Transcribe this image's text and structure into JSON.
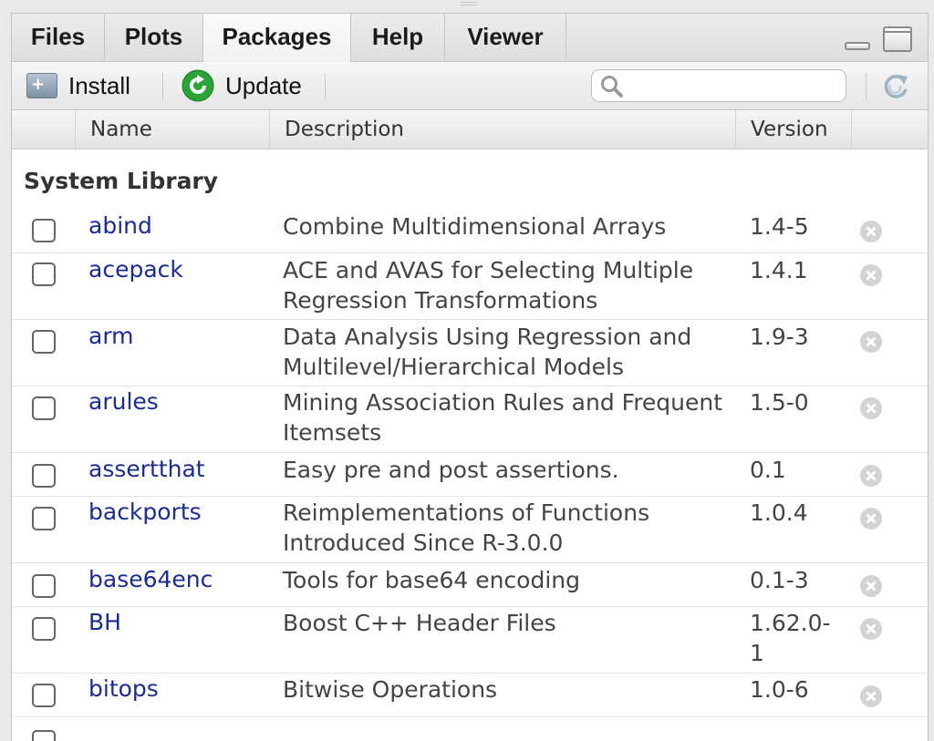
{
  "tabs": [
    {
      "label": "Files"
    },
    {
      "label": "Plots"
    },
    {
      "label": "Packages"
    },
    {
      "label": "Help"
    },
    {
      "label": "Viewer"
    }
  ],
  "active_tab": "Packages",
  "toolbar": {
    "install_label": "Install",
    "update_label": "Update",
    "search_value": "",
    "search_placeholder": ""
  },
  "columns": {
    "name": "Name",
    "description": "Description",
    "version": "Version"
  },
  "section_label": "System Library",
  "packages": [
    {
      "name": "abind",
      "description": "Combine Multidimensional Arrays",
      "version": "1.4-5",
      "checked": false
    },
    {
      "name": "acepack",
      "description": "ACE and AVAS for Selecting Multiple Regression Transformations",
      "version": "1.4.1",
      "checked": false
    },
    {
      "name": "arm",
      "description": "Data Analysis Using Regression and Multilevel/Hierarchical Models",
      "version": "1.9-3",
      "checked": false
    },
    {
      "name": "arules",
      "description": "Mining Association Rules and Frequent Itemsets",
      "version": "1.5-0",
      "checked": false
    },
    {
      "name": "assertthat",
      "description": "Easy pre and post assertions.",
      "version": "0.1",
      "checked": false
    },
    {
      "name": "backports",
      "description": "Reimplementations of Functions Introduced Since R-3.0.0",
      "version": "1.0.4",
      "checked": false
    },
    {
      "name": "base64enc",
      "description": "Tools for base64 encoding",
      "version": "0.1-3",
      "checked": false
    },
    {
      "name": "BH",
      "description": "Boost C++ Header Files",
      "version": "1.62.0-1",
      "checked": false
    },
    {
      "name": "bitops",
      "description": "Bitwise Operations",
      "version": "1.0-6",
      "checked": false
    }
  ],
  "colors": {
    "package_name": "#1b2c91",
    "text": "#444444",
    "update_icon": "#2aa337"
  },
  "icons": {
    "install": "install-icon",
    "update": "update-icon",
    "search": "search-icon",
    "refresh": "refresh-icon",
    "remove": "remove-icon",
    "minimize": "minimize-icon",
    "maximize": "maximize-icon"
  }
}
